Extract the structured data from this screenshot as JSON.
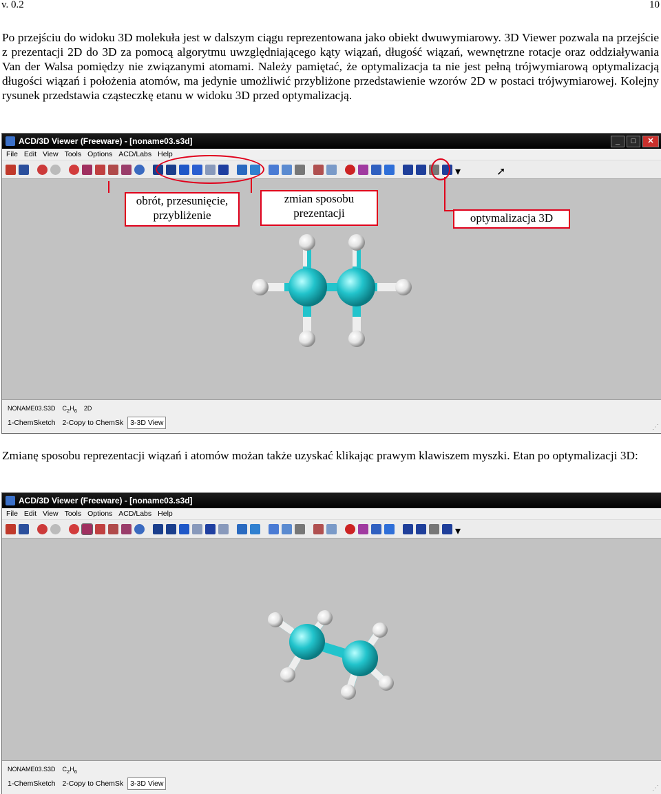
{
  "header": {
    "version": "v. 0.2",
    "page_number": "10"
  },
  "paragraph1": "Po przejściu do widoku 3D molekuła jest w dalszym ciągu reprezentowana jako obiekt dwuwymiarowy. 3D Viewer pozwala na przejście z prezentacji 2D do 3D za pomocą algorytmu uwzględniającego kąty wiązań, długość wiązań, wewnętrzne rotacje oraz oddziaływania Van der Walsa pomiędzy nie związanymi atomami. Należy pamiętać, że optymalizacja ta nie jest pełną trójwymiarową optymalizacją długości wiązań i położenia atomów, ma jedynie umożliwić przybliżone przedstawienie wzorów 2D w postaci trójwymiarowej. Kolejny rysunek przedstawia cząsteczkę etanu w widoku 3D przed optymalizacją.",
  "paragraph2": "Zmianę sposobu reprezentacji wiązań i atomów możan także uzyskać klikając prawym klawiszem myszki. Etan po optymalizacji 3D:",
  "window": {
    "title": "ACD/3D Viewer (Freeware) - [noname03.s3d]",
    "menu": [
      "File",
      "Edit",
      "View",
      "Tools",
      "Options",
      "ACD/Labs",
      "Help"
    ],
    "status_file": "NONAME03.S3D",
    "status_formula": "C2H6",
    "status_mode": "2D",
    "tabs": [
      "1-ChemSketch",
      "2-Copy to ChemSk",
      "3-3D View"
    ]
  },
  "callouts": {
    "rotate": "obrót, przesunięcie, przybliżenie",
    "representation": "zmian sposobu prezentacji",
    "optimize": "optymalizacja 3D"
  },
  "colors": {
    "carbon": "#22c4cc",
    "hydrogen": "#e8e8e8",
    "annotation": "#e0001b",
    "canvas": "#c2c2c2"
  }
}
